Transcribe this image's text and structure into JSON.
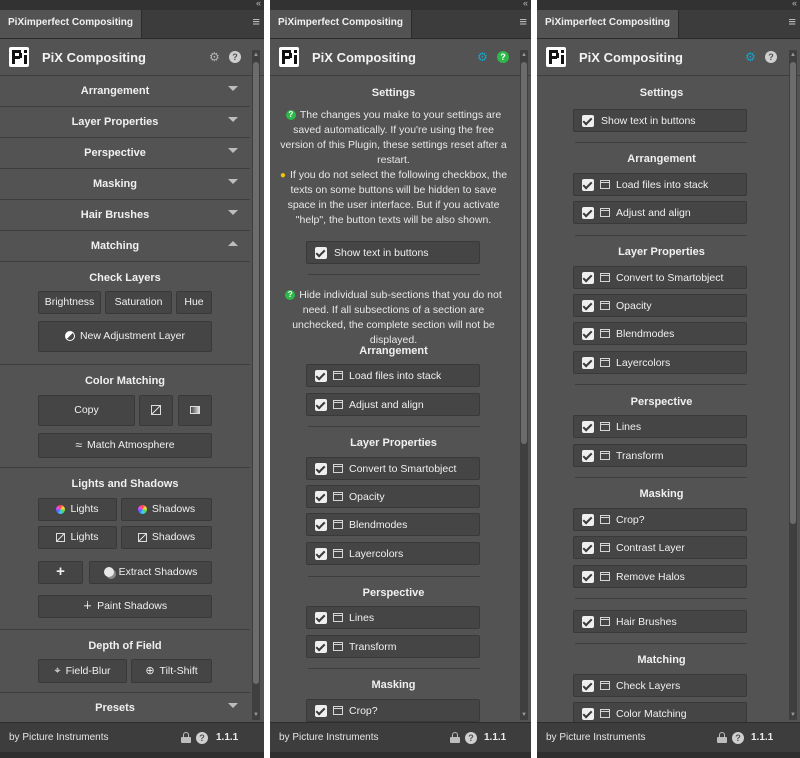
{
  "tab_title": "PiXimperfect Compositing",
  "header_title": "PiX Compositing",
  "footer": {
    "credit": "by Picture Instruments",
    "version": "1.1.1"
  },
  "colors": {
    "panel_bg": "#535353",
    "button_bg": "#454545",
    "help_green": "#2fb84a",
    "teal_gear": "#1aa3c8"
  },
  "panel1": {
    "sections": [
      "Arrangement",
      "Layer Properties",
      "Perspective",
      "Masking",
      "Hair Brushes",
      "Matching"
    ],
    "check_layers": {
      "title": "Check Layers",
      "brightness": "Brightness",
      "saturation": "Saturation",
      "hue": "Hue",
      "new_adjustment": "New Adjustment Layer"
    },
    "color_matching": {
      "title": "Color Matching",
      "copy": "Copy",
      "match_atmosphere": "Match Atmosphere"
    },
    "lights_shadows": {
      "title": "Lights and Shadows",
      "lights": "Lights",
      "shadows": "Shadows",
      "plus": "+",
      "extract_shadows": "Extract Shadows",
      "paint_shadows": "Paint Shadows"
    },
    "depth_of_field": {
      "title": "Depth of Field",
      "field_blur": "Field-Blur",
      "tilt_shift": "Tilt-Shift"
    },
    "presets": "Presets"
  },
  "panel2": {
    "settings_title": "Settings",
    "para1": "The changes you make to your settings are saved automatically. If you're using the free version of this Plugin, these settings reset after a restart.",
    "para2": "If you do not select the following checkbox, the texts on some buttons will be hidden to save space in the user interface. But if you activate \"help\", the button texts will be also shown.",
    "show_text": "Show text in buttons",
    "para3": "Hide individual sub-sections that you do not need. If all subsections of a section are unchecked, the complete section will not be displayed.",
    "groups": [
      {
        "title": "Arrangement",
        "items": [
          "Load files into stack",
          "Adjust and align"
        ]
      },
      {
        "title": "Layer Properties",
        "items": [
          "Convert to Smartobject",
          "Opacity",
          "Blendmodes",
          "Layercolors"
        ]
      },
      {
        "title": "Perspective",
        "items": [
          "Lines",
          "Transform"
        ]
      },
      {
        "title": "Masking",
        "items": [
          "Crop?"
        ]
      }
    ]
  },
  "panel3": {
    "settings_title": "Settings",
    "show_text": "Show text in buttons",
    "groups": [
      {
        "title": "Arrangement",
        "items": [
          "Load files into stack",
          "Adjust and align"
        ]
      },
      {
        "title": "Layer Properties",
        "items": [
          "Convert to Smartobject",
          "Opacity",
          "Blendmodes",
          "Layercolors"
        ]
      },
      {
        "title": "Perspective",
        "items": [
          "Lines",
          "Transform"
        ]
      },
      {
        "title": "Masking",
        "items": [
          "Crop?",
          "Contrast Layer",
          "Remove Halos"
        ]
      },
      {
        "title": "",
        "items": [
          "Hair Brushes"
        ]
      },
      {
        "title": "Matching",
        "items": [
          "Check Layers",
          "Color Matching"
        ]
      }
    ]
  }
}
